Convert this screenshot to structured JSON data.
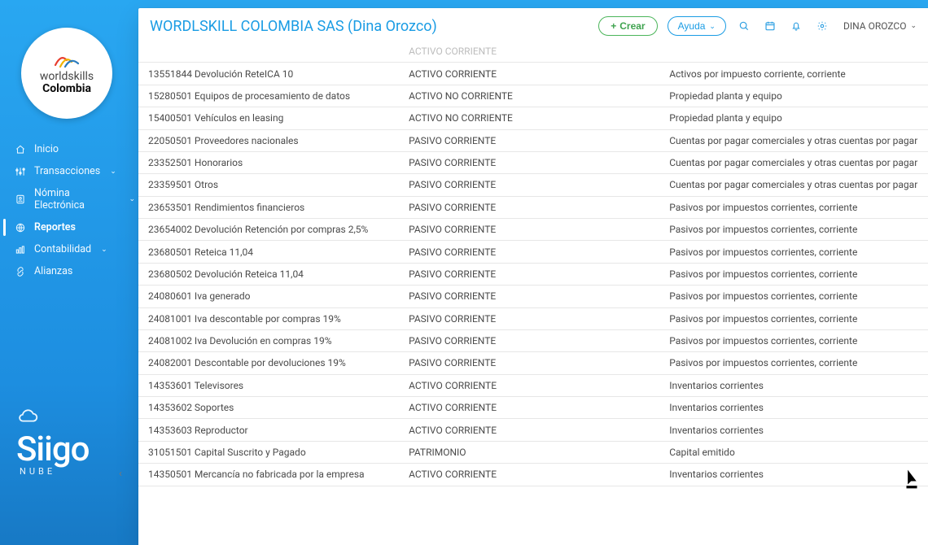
{
  "app_title": "WORDLSKILL COLOMBIA SAS (Dina Orozco)",
  "user_name": "DINA OROZCO",
  "logo": {
    "line1": "worldskills",
    "line2": "Colombia"
  },
  "actions": {
    "create": "Crear",
    "help": "Ayuda"
  },
  "brand": {
    "name": "Siigo",
    "sub": "NUBE"
  },
  "nav": [
    {
      "key": "inicio",
      "label": "Inicio",
      "icon": "home",
      "submenu": false,
      "active": false
    },
    {
      "key": "transacciones",
      "label": "Transacciones",
      "icon": "sliders",
      "submenu": true,
      "active": false
    },
    {
      "key": "nomina",
      "label": "Nómina Electrónica",
      "icon": "badge",
      "submenu": true,
      "active": false
    },
    {
      "key": "reportes",
      "label": "Reportes",
      "icon": "globe",
      "submenu": false,
      "active": true
    },
    {
      "key": "contabilidad",
      "label": "Contabilidad",
      "icon": "bars",
      "submenu": true,
      "active": false
    },
    {
      "key": "alianzas",
      "label": "Alianzas",
      "icon": "link",
      "submenu": false,
      "active": false
    }
  ],
  "table": {
    "rows": [
      {
        "c1": "",
        "c2": "ACTIVO CORRIENTE",
        "c3": "",
        "cutoff": true
      },
      {
        "c1": "13551844 Devolución ReteICA 10",
        "c2": "ACTIVO CORRIENTE",
        "c3": "Activos por impuesto corriente, corriente"
      },
      {
        "c1": "15280501 Equipos de procesamiento de datos",
        "c2": "ACTIVO NO CORRIENTE",
        "c3": "Propiedad planta y equipo"
      },
      {
        "c1": "15400501 Vehículos en leasing",
        "c2": "ACTIVO NO CORRIENTE",
        "c3": "Propiedad planta y equipo"
      },
      {
        "c1": "22050501 Proveedores nacionales",
        "c2": "PASIVO CORRIENTE",
        "c3": "Cuentas por pagar comerciales y otras cuentas por pagar"
      },
      {
        "c1": "23352501 Honorarios",
        "c2": "PASIVO CORRIENTE",
        "c3": "Cuentas por pagar comerciales y otras cuentas por pagar"
      },
      {
        "c1": "23359501 Otros",
        "c2": "PASIVO CORRIENTE",
        "c3": "Cuentas por pagar comerciales y otras cuentas por pagar"
      },
      {
        "c1": "23653501 Rendimientos financieros",
        "c2": "PASIVO CORRIENTE",
        "c3": "Pasivos por impuestos corrientes, corriente"
      },
      {
        "c1": "23654002 Devolución Retención por compras 2,5%",
        "c2": "PASIVO CORRIENTE",
        "c3": "Pasivos por impuestos corrientes, corriente"
      },
      {
        "c1": "23680501 Reteica 11,04",
        "c2": "PASIVO CORRIENTE",
        "c3": "Pasivos por impuestos corrientes, corriente"
      },
      {
        "c1": "23680502 Devolución Reteica 11,04",
        "c2": "PASIVO CORRIENTE",
        "c3": "Pasivos por impuestos corrientes, corriente"
      },
      {
        "c1": "24080601 Iva generado",
        "c2": "PASIVO CORRIENTE",
        "c3": "Pasivos por impuestos corrientes, corriente"
      },
      {
        "c1": "24081001 Iva descontable por compras 19%",
        "c2": "PASIVO CORRIENTE",
        "c3": "Pasivos por impuestos corrientes, corriente"
      },
      {
        "c1": "24081002 Iva Devolución en compras 19%",
        "c2": "PASIVO CORRIENTE",
        "c3": "Pasivos por impuestos corrientes, corriente"
      },
      {
        "c1": "24082001 Descontable por devoluciones 19%",
        "c2": "PASIVO CORRIENTE",
        "c3": "Pasivos por impuestos corrientes, corriente"
      },
      {
        "c1": "14353601 Televisores",
        "c2": "ACTIVO CORRIENTE",
        "c3": "Inventarios corrientes"
      },
      {
        "c1": "14353602 Soportes",
        "c2": "ACTIVO CORRIENTE",
        "c3": "Inventarios corrientes"
      },
      {
        "c1": "14353603 Reproductor",
        "c2": "ACTIVO CORRIENTE",
        "c3": "Inventarios corrientes"
      },
      {
        "c1": "31051501 Capital Suscrito y Pagado",
        "c2": "PATRIMONIO",
        "c3": "Capital emitido"
      },
      {
        "c1": "14350501 Mercancía no fabricada por la empresa",
        "c2": "ACTIVO CORRIENTE",
        "c3": "Inventarios corrientes"
      }
    ]
  }
}
